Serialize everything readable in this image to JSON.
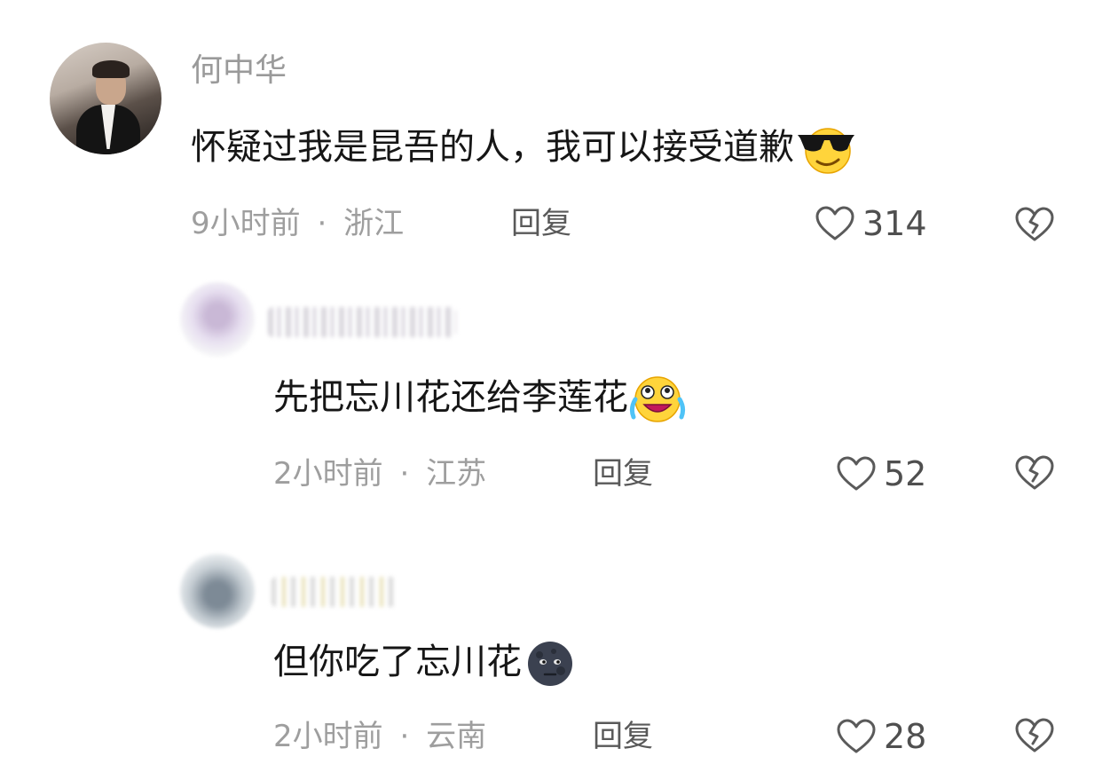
{
  "comments": [
    {
      "username": "何中华",
      "text": "怀疑过我是昆吾的人，我可以接受道歉",
      "emoji": "cool-sunglasses-emoji",
      "time": "9小时前",
      "location": "浙江",
      "reply_label": "回复",
      "likes": "314"
    },
    {
      "username": "",
      "text": "先把忘川花还给李莲花",
      "emoji": "crying-laughing-emoji",
      "time": "2小时前",
      "location": "江苏",
      "reply_label": "回复",
      "likes": "52"
    },
    {
      "username": "",
      "text": "但你吃了忘川花",
      "emoji": "dark-moon-face-emoji",
      "time": "2小时前",
      "location": "云南",
      "reply_label": "回复",
      "likes": "28"
    }
  ],
  "separator": "·",
  "icons": {
    "like": "heart-outline-icon",
    "dislike": "broken-heart-icon"
  },
  "colors": {
    "text": "#161616",
    "meta": "#9e9e9e",
    "emoji_yellow": "#ffd43b",
    "moon": "#3b4150"
  }
}
